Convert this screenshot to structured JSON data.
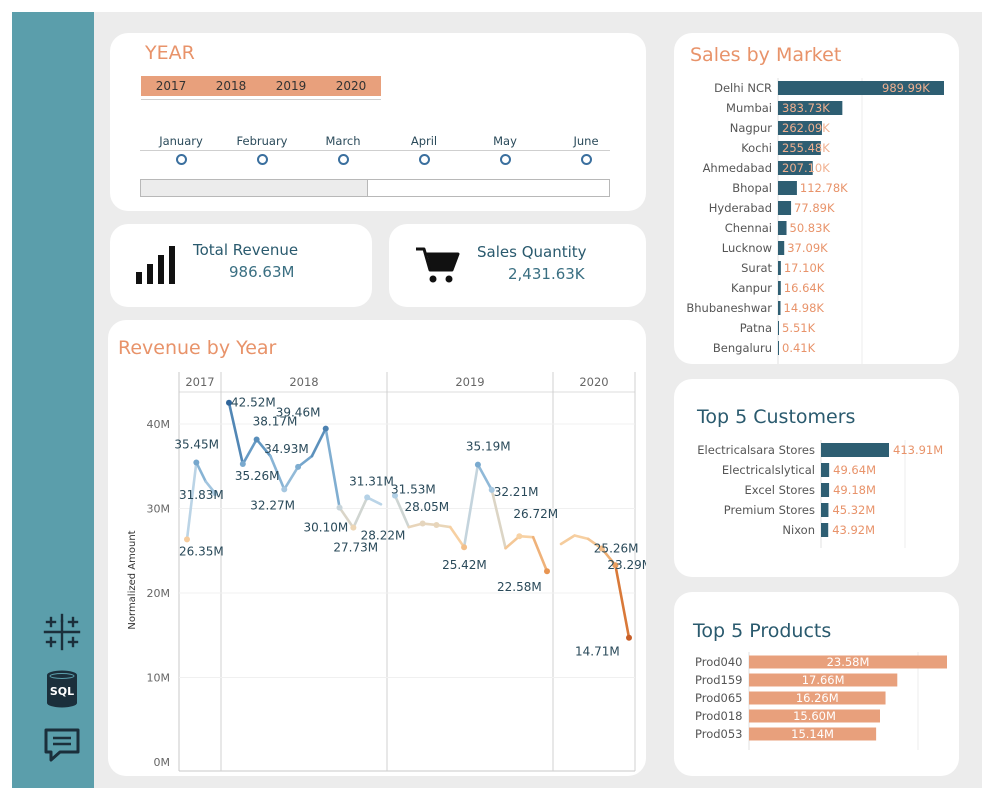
{
  "colors": {
    "sidebar": "#5b9eab",
    "accent_orange": "#e8936a",
    "navy": "#2a5a6e",
    "bar_navy": "#2e5e72",
    "bar_orange": "#e8a07c"
  },
  "sidebar": {
    "icons": [
      "tableau-icon",
      "sql-database-icon",
      "chat-icon"
    ],
    "sql_label": "SQL"
  },
  "filter": {
    "title": "YEAR",
    "years": [
      "2017",
      "2018",
      "2019",
      "2020"
    ],
    "months": [
      "January",
      "February",
      "March",
      "April",
      "May",
      "June"
    ]
  },
  "kpis": {
    "revenue": {
      "label": "Total Revenue",
      "value": "986.63M",
      "icon": "bar-signal-icon"
    },
    "quantity": {
      "label": "Sales Quantity",
      "value": "2,431.63K",
      "icon": "shopping-cart-icon"
    }
  },
  "revenue_chart": {
    "title": "Revenue by Year",
    "ylabel": "Normalized Amount",
    "yticks": [
      "0M",
      "10M",
      "20M",
      "30M",
      "40M"
    ]
  },
  "chart_data": [
    {
      "type": "line",
      "title": "Revenue by Year",
      "ylabel": "Normalized Amount",
      "ylim": [
        0,
        45
      ],
      "unit": "M",
      "panels": [
        {
          "year": "2017",
          "values": [
            26.35,
            35.45,
            33.2,
            31.83
          ]
        },
        {
          "year": "2018",
          "values": [
            42.52,
            35.26,
            38.17,
            36.2,
            32.27,
            34.93,
            36.2,
            39.46,
            30.1,
            27.73,
            31.31,
            30.5
          ]
        },
        {
          "year": "2019",
          "values": [
            31.53,
            27.8,
            28.22,
            28.05,
            27.8,
            25.42,
            35.19,
            32.21,
            25.3,
            26.72,
            26.6,
            22.58
          ]
        },
        {
          "year": "2020",
          "values": [
            25.8,
            26.8,
            26.4,
            25.26,
            23.29,
            14.71
          ]
        }
      ],
      "labels": [
        {
          "panel": 0,
          "index": 0,
          "text": "26.35M"
        },
        {
          "panel": 0,
          "index": 1,
          "text": "35.45M"
        },
        {
          "panel": 0,
          "index": 3,
          "text": "31.83M"
        },
        {
          "panel": 1,
          "index": 0,
          "text": "42.52M"
        },
        {
          "panel": 1,
          "index": 1,
          "text": "35.26M"
        },
        {
          "panel": 1,
          "index": 2,
          "text": "38.17M"
        },
        {
          "panel": 1,
          "index": 4,
          "text": "32.27M"
        },
        {
          "panel": 1,
          "index": 5,
          "text": "34.93M"
        },
        {
          "panel": 1,
          "index": 7,
          "text": "39.46M"
        },
        {
          "panel": 1,
          "index": 8,
          "text": "30.10M"
        },
        {
          "panel": 1,
          "index": 9,
          "text": "27.73M"
        },
        {
          "panel": 1,
          "index": 10,
          "text": "31.31M"
        },
        {
          "panel": 2,
          "index": 0,
          "text": "31.53M"
        },
        {
          "panel": 2,
          "index": 2,
          "text": "28.22M"
        },
        {
          "panel": 2,
          "index": 3,
          "text": "28.05M"
        },
        {
          "panel": 2,
          "index": 5,
          "text": "25.42M"
        },
        {
          "panel": 2,
          "index": 6,
          "text": "35.19M"
        },
        {
          "panel": 2,
          "index": 7,
          "text": "32.21M"
        },
        {
          "panel": 2,
          "index": 9,
          "text": "26.72M"
        },
        {
          "panel": 2,
          "index": 11,
          "text": "22.58M"
        },
        {
          "panel": 3,
          "index": 3,
          "text": "25.26M"
        },
        {
          "panel": 3,
          "index": 4,
          "text": "23.29M"
        },
        {
          "panel": 3,
          "index": 5,
          "text": "14.71M"
        }
      ]
    },
    {
      "type": "bar",
      "title": "Sales by Market",
      "orientation": "horizontal",
      "categories": [
        "Delhi NCR",
        "Mumbai",
        "Nagpur",
        "Kochi",
        "Ahmedabad",
        "Bhopal",
        "Hyderabad",
        "Chennai",
        "Lucknow",
        "Surat",
        "Kanpur",
        "Bhubaneshwar",
        "Patna",
        "Bengaluru"
      ],
      "values": [
        989.99,
        383.73,
        262.09,
        255.48,
        207.1,
        112.78,
        77.89,
        50.83,
        37.09,
        17.1,
        16.64,
        14.98,
        5.51,
        0.41
      ],
      "labels": [
        "989.99K",
        "383.73K",
        "262.09K",
        "255.48K",
        "207.10K",
        "112.78K",
        "77.89K",
        "50.83K",
        "37.09K",
        "17.10K",
        "16.64K",
        "14.98K",
        "5.51K",
        "0.41K"
      ]
    },
    {
      "type": "bar",
      "title": "Top 5 Customers",
      "orientation": "horizontal",
      "categories": [
        "Electricalsara Stores",
        "Electricalslytical",
        "Excel Stores",
        "Premium Stores",
        "Nixon"
      ],
      "values": [
        413.91,
        49.64,
        49.18,
        45.32,
        43.92
      ],
      "labels": [
        "413.91M",
        "49.64M",
        "49.18M",
        "45.32M",
        "43.92M"
      ]
    },
    {
      "type": "bar",
      "title": "Top 5 Products",
      "orientation": "horizontal",
      "categories": [
        "Prod040",
        "Prod159",
        "Prod065",
        "Prod018",
        "Prod053"
      ],
      "values": [
        23.58,
        17.66,
        16.26,
        15.6,
        15.14
      ],
      "labels": [
        "23.58M",
        "17.66M",
        "16.26M",
        "15.60M",
        "15.14M"
      ]
    }
  ]
}
